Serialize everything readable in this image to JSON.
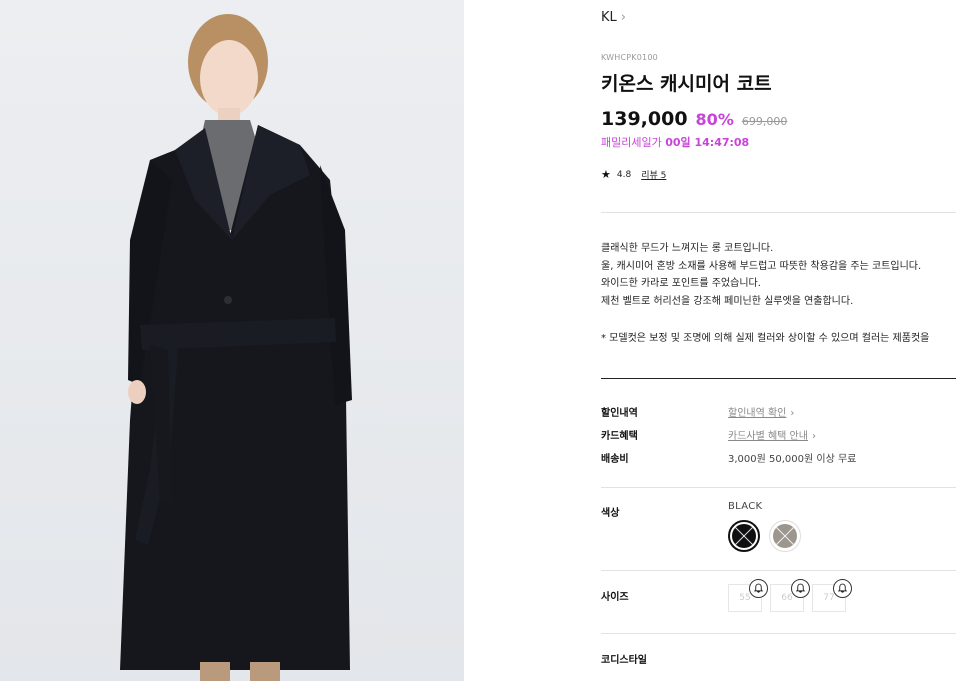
{
  "product": {
    "brand": "KL",
    "code": "KWHCPK0100",
    "title": "키온스 캐시미어 코트",
    "price": "139,000",
    "discount": "80%",
    "original_price": "699,000",
    "sale_label": "패밀리세일가",
    "sale_timer": "00일 14:47:08",
    "rating": "4.8",
    "review_link": "리뷰 5",
    "image_icon": "coat-model-image"
  },
  "description": {
    "lines": [
      "클래식한 무드가 느껴지는 롱 코트입니다.",
      "울, 캐시미어 혼방 소재를 사용해 부드럽고 따뜻한 착용감을 주는 코트입니다.",
      "와이드한 카라로 포인트를 주었습니다.",
      "제천 벨트로 허리선을 강조해 페미닌한 실루엣을 연출합니다."
    ],
    "note": "* 모델컷은 보정 및 조명에 의해 실제 컬러와 상이할 수 있으며 컬러는 제품컷을"
  },
  "benefits": {
    "discount_label": "할인내역",
    "discount_link": "할인내역 확인",
    "card_label": "카드혜택",
    "card_link": "카드사별 혜택 안내",
    "shipping_label": "배송비",
    "shipping_value": "3,000원 50,000원 이상 무료"
  },
  "options": {
    "color_label": "색상",
    "selected_color": "BLACK",
    "swatches": [
      {
        "name": "BLACK",
        "color": "#0f0f12",
        "selected": true
      },
      {
        "name": "GRAY",
        "color": "#9c968f",
        "selected": false
      }
    ],
    "size_label": "사이즈",
    "sizes": [
      "55",
      "66",
      "77"
    ],
    "coordi_label": "코디스타일"
  },
  "colors": {
    "accent": "#c844d8",
    "background_image": "#e8eaee"
  }
}
